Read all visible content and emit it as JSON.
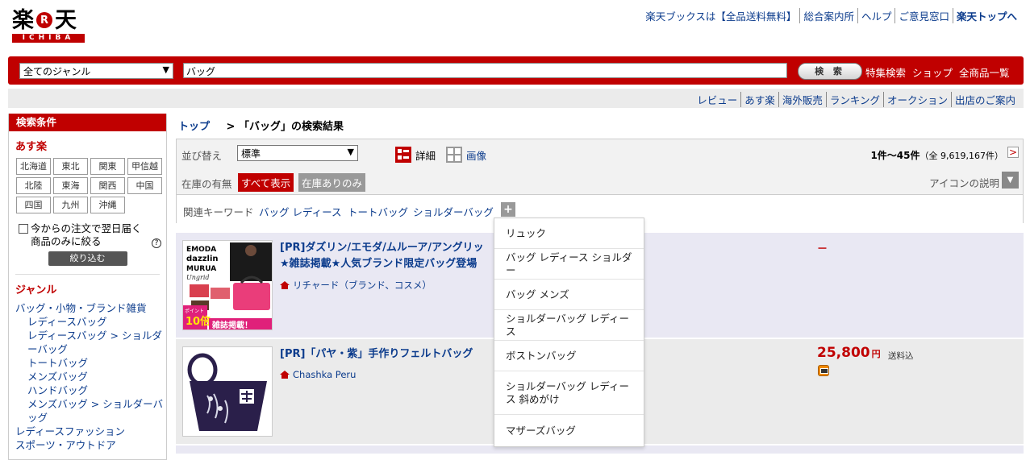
{
  "header": {
    "logo_text_left": "楽",
    "logo_badge": "R",
    "logo_text_right": "天",
    "logo_sub": "ICHIBA",
    "top_links": [
      "楽天ブックスは【全品送料無料】",
      "総合案内所",
      "ヘルプ",
      "ご意見窓口",
      "楽天トップへ"
    ]
  },
  "search": {
    "genre_value": "全てのジャンル",
    "keyword_value": "バッグ",
    "button_label": "検 索",
    "links": [
      "特集検索",
      "ショップ",
      "全商品一覧"
    ]
  },
  "subnav": {
    "links": [
      "レビュー",
      "あす楽",
      "海外販売",
      "ランキング",
      "オークション",
      "出店のご案内"
    ]
  },
  "sidebar": {
    "title": "検索条件",
    "asuraku_title": "あす楽",
    "regions": [
      "北海道",
      "東北",
      "関東",
      "甲信越",
      "北陸",
      "東海",
      "関西",
      "中国",
      "四国",
      "九州",
      "沖縄"
    ],
    "nextday_text": "今からの注文で翌日届く商品のみに絞る",
    "help_label": "?",
    "narrow_button": "絞り込む",
    "genre_title": "ジャンル",
    "genres": [
      {
        "label": "バッグ・小物・ブランド雑貨",
        "indent": false
      },
      {
        "label": "レディースバッグ",
        "indent": true
      },
      {
        "label": "レディースバッグ > ショルダーバッグ",
        "indent": true
      },
      {
        "label": "トートバッグ",
        "indent": true
      },
      {
        "label": "メンズバッグ",
        "indent": true
      },
      {
        "label": "ハンドバッグ",
        "indent": true
      },
      {
        "label": "メンズバッグ > ショルダーバッグ",
        "indent": true
      },
      {
        "label": "レディースファッション",
        "indent": false
      },
      {
        "label": "スポーツ・アウトドア",
        "indent": false
      }
    ]
  },
  "breadcrumb": {
    "top": "トップ",
    "separator": ">",
    "current": "「バッグ」の検索結果"
  },
  "controls": {
    "sort_label": "並び替え",
    "sort_value": "標準",
    "view_detail": "詳細",
    "view_image": "画像",
    "count_range": "1件～45件",
    "count_total": "（全 9,619,167件）",
    "next_label": ">",
    "stock_label": "在庫の有無",
    "stock_all": "すべて表示",
    "stock_instock": "在庫ありのみ",
    "icon_desc": "アイコンの説明",
    "related_label": "関連キーワード",
    "related": [
      "バッグ レディース",
      "トートバッグ",
      "ショルダーバッグ"
    ],
    "plus_label": "+"
  },
  "dropdown": {
    "items": [
      "リュック",
      "バッグ レディース ショルダー",
      "バッグ メンズ",
      "ショルダーバッグ レディース",
      "ボストンバッグ",
      "ショルダーバッグ レディース 斜めがけ",
      "マザーズバッグ"
    ]
  },
  "results": [
    {
      "title_line1": "[PR]ダズリン/エモダ/ムルーア/アングリッ",
      "title_line2": "★雑誌掲載★人気ブランド限定バッグ登場",
      "shop": "リチャード（ブランド、コスメ）",
      "price_text": "－",
      "thumb_text": [
        "EMODA",
        "dazzlin",
        "MURUA",
        "Ungrid",
        "ポイント",
        "10倍",
        "雑誌掲載！"
      ]
    },
    {
      "title_line1": "[PR]「パヤ・紫」手作りフェルトバッグ",
      "shop": "Chashka Peru",
      "price": "25,800",
      "price_unit": "円",
      "shipping": "送料込"
    }
  ],
  "colors": {
    "brand_red": "#c00000",
    "link_blue": "#0b3b8c",
    "result_bg": "#e9e8f3"
  }
}
